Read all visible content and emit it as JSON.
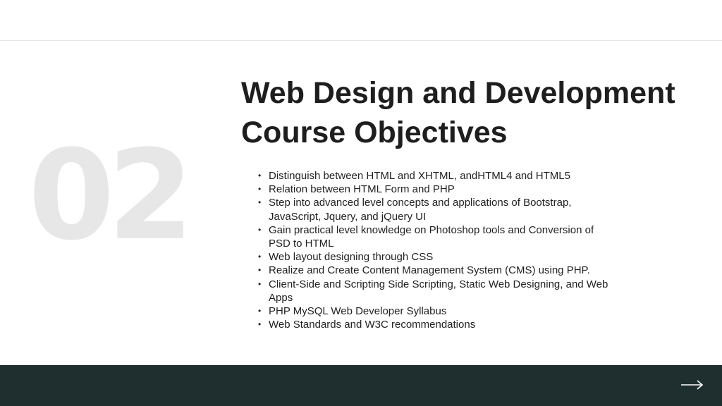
{
  "slide": {
    "number": "02",
    "title_lines": [
      "Web Design and Development",
      "Course Objectives"
    ],
    "objectives": [
      "Distinguish between HTML and XHTML, andHTML4 and HTML5",
      "Relation between HTML Form and PHP",
      "Step into advanced level concepts and applications of Bootstrap, JavaScript, Jquery, and jQuery UI",
      "Gain practical level knowledge on Photoshop tools and Conversion of PSD to HTML",
      "Web layout designing through CSS",
      "Realize and Create Content Management System (CMS) using PHP.",
      "Client-Side and Scripting Side Scripting, Static Web Designing, and Web Apps",
      "PHP MySQL Web Developer Syllabus",
      "Web Standards and W3C recommendations"
    ],
    "bullet_glyph": "•"
  },
  "footer": {
    "next_icon": "arrow-right-icon"
  },
  "colors": {
    "background": "#ffffff",
    "footer_bar": "#1f2e2f",
    "big_number": "#e7e7e7",
    "title": "#1e1e1e",
    "body_text": "#222222",
    "arrow": "#ffffff"
  }
}
